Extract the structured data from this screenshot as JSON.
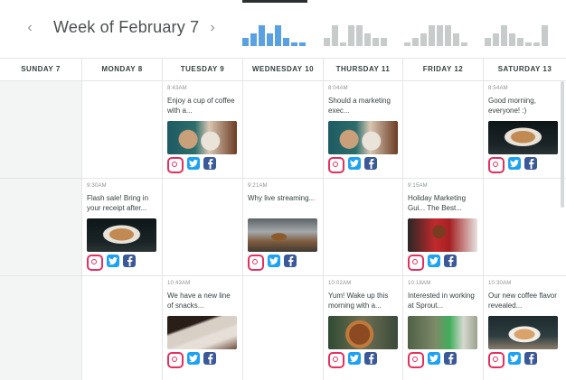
{
  "header": {
    "week_title": "Week of February 7",
    "prev_icon": "chevron-left-icon",
    "next_icon": "chevron-right-icon"
  },
  "sparklines": [
    {
      "color": "#5aa1e3",
      "levels": [
        0.35,
        0.55,
        0.9,
        0.55,
        0.9,
        0.35,
        0.15,
        0.15
      ]
    },
    {
      "color": "#c7cbcb",
      "levels": [
        0.35,
        0.9,
        0.15,
        0.9,
        0.9,
        0.55,
        0.35,
        0.35
      ]
    },
    {
      "color": "#c7cbcb",
      "levels": [
        0.15,
        0.35,
        0.55,
        0.9,
        0.9,
        0.9,
        0.55,
        0.15
      ]
    },
    {
      "color": "#c7cbcb",
      "levels": [
        0.35,
        0.55,
        0.9,
        0.55,
        0.35,
        0.15,
        0.15,
        0.9
      ]
    }
  ],
  "days": [
    "SUNDAY 7",
    "MONDAY 8",
    "TUESDAY 9",
    "WEDNESDAY 10",
    "THURSDAY 11",
    "FRIDAY 12",
    "SATURDAY 13"
  ],
  "posts": [
    {
      "day": 2,
      "slot": 0,
      "time": "8:43AM",
      "text": "Enjoy a cup of coffee with a...",
      "image": "mug-photo",
      "networks": [
        "instagram",
        "twitter",
        "facebook"
      ]
    },
    {
      "day": 4,
      "slot": 0,
      "time": "8:04AM",
      "text": "Should a marketing exec...",
      "image": "mug-photo",
      "networks": [
        "instagram",
        "twitter",
        "facebook"
      ]
    },
    {
      "day": 6,
      "slot": 0,
      "time": "8:54AM",
      "text": "Good morning, everyone! :)",
      "image": "latte-photo",
      "networks": [
        "instagram",
        "twitter",
        "facebook"
      ]
    },
    {
      "day": 1,
      "slot": 1,
      "time": "9:30AM",
      "text": "Flash sale! Bring in your receipt after...",
      "image": "latte-photo",
      "networks": [
        "instagram",
        "twitter",
        "facebook"
      ]
    },
    {
      "day": 3,
      "slot": 1,
      "time": "9:21AM",
      "text": "Why live streaming...",
      "image": "espresso-photo",
      "networks": [
        "instagram",
        "twitter",
        "facebook"
      ]
    },
    {
      "day": 5,
      "slot": 1,
      "time": "9:15AM",
      "text": "Holiday Marketing Gui... The Best...",
      "image": "red-sweater-photo",
      "networks": [
        "instagram",
        "twitter",
        "facebook"
      ]
    },
    {
      "day": 2,
      "slot": 2,
      "time": "10:43AM",
      "text": "We have a new line of snacks...",
      "image": "snack-photo",
      "networks": [
        "instagram",
        "twitter",
        "facebook"
      ]
    },
    {
      "day": 4,
      "slot": 2,
      "time": "10:02AM",
      "text": "Yum! Wake up this morning with a...",
      "image": "pastry-photo",
      "networks": [
        "instagram",
        "twitter",
        "facebook"
      ]
    },
    {
      "day": 5,
      "slot": 2,
      "time": "10:18AM",
      "text": "Interested in working at Sprout...",
      "image": "laptop-photo",
      "networks": [
        "instagram",
        "twitter",
        "facebook"
      ]
    },
    {
      "day": 6,
      "slot": 2,
      "time": "10:30AM",
      "text": "Our new coffee flavor revealed...",
      "image": "coffee-pour-photo",
      "networks": [
        "instagram",
        "twitter",
        "facebook"
      ]
    }
  ]
}
